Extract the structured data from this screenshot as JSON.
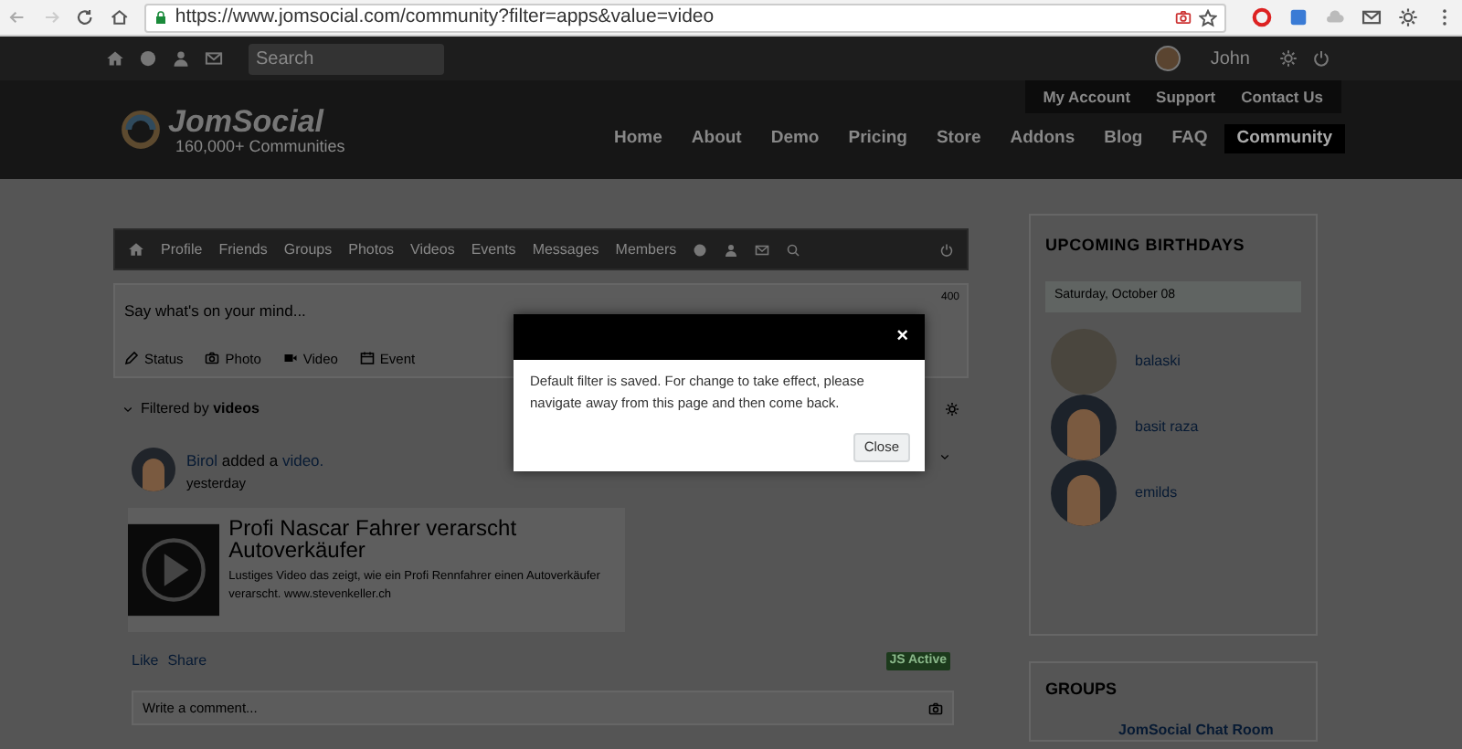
{
  "browser": {
    "url": "https://www.jomsocial.com/community?filter=apps&value=video"
  },
  "top_bar": {
    "search": {
      "placeholder": "Search"
    },
    "user": "John"
  },
  "header": {
    "logo": {
      "name": "JomSocial",
      "tagline": "160,000+ Communities"
    },
    "account_links": [
      "My Account",
      "Support",
      "Contact Us"
    ],
    "nav": [
      {
        "label": "Home",
        "selected": false
      },
      {
        "label": "About",
        "selected": false
      },
      {
        "label": "Demo",
        "selected": false
      },
      {
        "label": "Pricing",
        "selected": false
      },
      {
        "label": "Store",
        "selected": false
      },
      {
        "label": "Addons",
        "selected": false
      },
      {
        "label": "Blog",
        "selected": false
      },
      {
        "label": "FAQ",
        "selected": false
      },
      {
        "label": "Community",
        "selected": true
      }
    ]
  },
  "community_toolbar": [
    "Profile",
    "Friends",
    "Groups",
    "Photos",
    "Videos",
    "Events",
    "Messages",
    "Members"
  ],
  "composer": {
    "placeholder": "Say what's on your mind...",
    "counter": "400",
    "actions": [
      {
        "kind": "status",
        "label": "Status"
      },
      {
        "kind": "photo",
        "label": "Photo"
      },
      {
        "kind": "video",
        "label": "Video"
      },
      {
        "kind": "event",
        "label": "Event"
      }
    ]
  },
  "filter": {
    "text": "Filtered by **videos**"
  },
  "post": {
    "author": "Birol",
    "action": "added a",
    "object": "video.",
    "time": "yesterday",
    "video": {
      "title": "Profi Nascar Fahrer verarscht Autoverkäufer",
      "description": "Lustiges Video das zeigt, wie ein Profi Rennfahrer einen Autoverkäufer verarscht. www.stevenkeller.ch"
    },
    "links": [
      "Like",
      "Share"
    ],
    "badge": "JS Active",
    "comment_placeholder": "Write a comment..."
  },
  "birthdays": {
    "title": "UPCOMING BIRTHDAYS",
    "date": "Saturday, October 08",
    "people": [
      {
        "name": "balaski",
        "kind": "photo"
      },
      {
        "name": "basit raza",
        "kind": "default"
      },
      {
        "name": "emilds",
        "kind": "default"
      }
    ]
  },
  "groups": {
    "title": "GROUPS",
    "items": [
      "JomSocial Chat Room"
    ]
  },
  "dialog": {
    "message": "Default filter is saved. For change to take effect, please navigate away from this page and then come back.",
    "close_symbol": "×",
    "button": "Close"
  }
}
